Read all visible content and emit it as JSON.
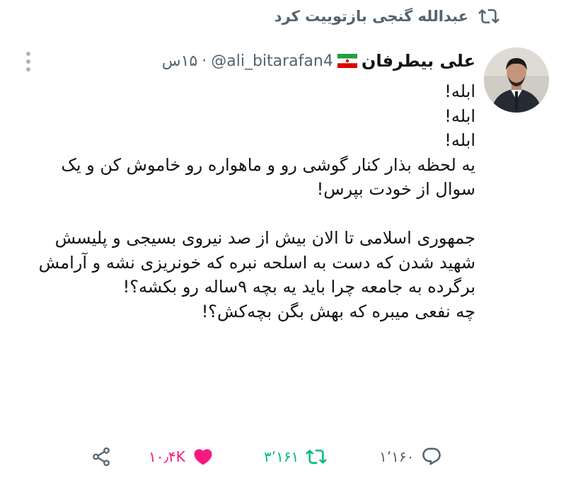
{
  "retweet_context": {
    "text": "عبدالله گنجی بازتوییت کرد",
    "icon": "retweet-icon"
  },
  "author": {
    "name": "علی بیطرفان",
    "flag": "iran-flag",
    "handle": "@ali_bitarafan4",
    "separator": "·",
    "time": "۱۵س"
  },
  "tweet": {
    "text": "ابله!\nابله!\nابله!\nیه لحظه بذار کنار گوشی رو و ماهواره رو خاموش کن و یک سوال از خودت بپرس!\n\nجمهوری اسلامی تا الان بیش از صد نیروی بسیجی و پلیسش شهید شدن که دست به اسلحه نبره که خونریزی نشه و آرامش برگرده به جامعه چرا باید یه بچه ۹ساله رو بکشه؟!\nچه نفعی میبره که بهش بگن بچه‌کش؟!"
  },
  "actions": {
    "reply_count": "۱٬۱۶۰",
    "retweet_count": "۳٬۱۶۱",
    "like_count": "۱۰٫۴K",
    "share_icon": "share-icon"
  },
  "colors": {
    "muted": "#536471",
    "text": "#0f1419",
    "retweet_active": "#00ba7c",
    "like_active": "#f91880"
  }
}
